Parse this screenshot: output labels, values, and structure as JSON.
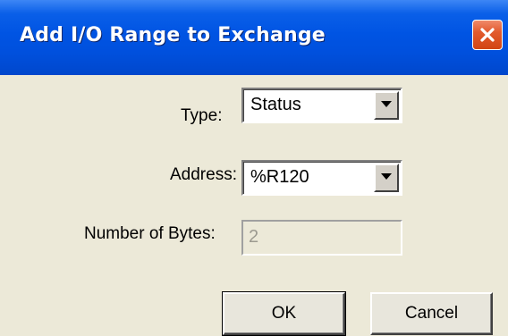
{
  "window": {
    "title": "Add I/O Range to Exchange"
  },
  "form": {
    "type_label": "Type:",
    "type_value": "Status",
    "address_label": "Address:",
    "address_value": "%R120",
    "bytes_label": "Number of Bytes:",
    "bytes_value": "2"
  },
  "buttons": {
    "ok_label": "OK",
    "cancel_label": "Cancel"
  },
  "icons": {
    "close": "close-icon",
    "dropdown": "chevron-down-icon"
  },
  "colors": {
    "titlebar": "#0054e3",
    "close_button": "#d24513",
    "dialog_background": "#ece9d8",
    "disabled_text": "#9c9a90"
  }
}
